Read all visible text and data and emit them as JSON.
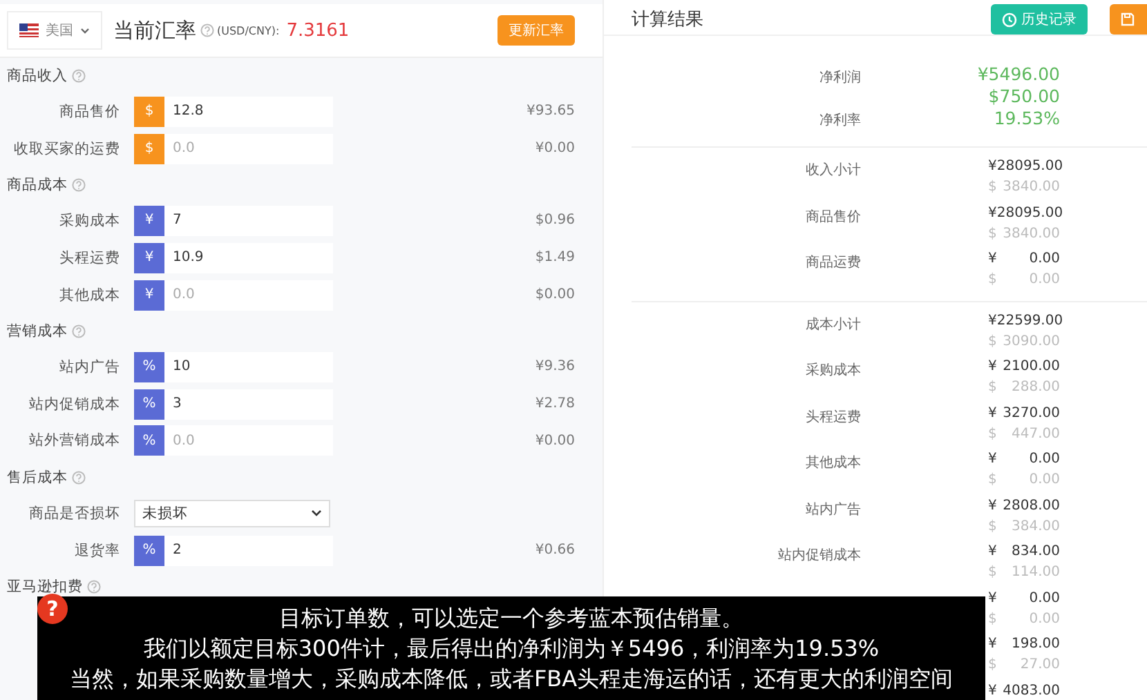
{
  "header": {
    "country": "美国",
    "rate_label": "当前汇率",
    "rate_unit": "(USD/CNY):",
    "rate_value": "7.3161",
    "update_button": "更新汇率"
  },
  "sections": [
    {
      "title": "商品收入",
      "rows": [
        {
          "kind": "input",
          "label": "商品售价",
          "prefix": "$",
          "color": "#f7931e",
          "value": "12.8",
          "converted": "¥93.65"
        },
        {
          "kind": "input",
          "label": "收取买家的运费",
          "prefix": "$",
          "color": "#f7931e",
          "placeholder": "0.0",
          "converted": "¥0.00"
        }
      ]
    },
    {
      "title": "商品成本",
      "rows": [
        {
          "kind": "input",
          "label": "采购成本",
          "prefix": "¥",
          "color": "#5b6bd5",
          "value": "7",
          "converted": "$0.96"
        },
        {
          "kind": "input",
          "label": "头程运费",
          "prefix": "¥",
          "color": "#5b6bd5",
          "value": "10.9",
          "converted": "$1.49"
        },
        {
          "kind": "input",
          "label": "其他成本",
          "prefix": "¥",
          "color": "#5b6bd5",
          "placeholder": "0.0",
          "converted": "$0.00"
        }
      ]
    },
    {
      "title": "营销成本",
      "rows": [
        {
          "kind": "input",
          "label": "站内广告",
          "prefix": "%",
          "color": "#5b6bd5",
          "value": "10",
          "converted": "¥9.36"
        },
        {
          "kind": "input",
          "label": "站内促销成本",
          "prefix": "%",
          "color": "#5b6bd5",
          "value": "3",
          "converted": "¥2.78"
        },
        {
          "kind": "input",
          "label": "站外营销成本",
          "prefix": "%",
          "color": "#5b6bd5",
          "placeholder": "0.0",
          "converted": "¥0.00"
        }
      ]
    },
    {
      "title": "售后成本",
      "rows": [
        {
          "kind": "select",
          "label": "商品是否损坏",
          "value": "未损坏"
        },
        {
          "kind": "input",
          "label": "退货率",
          "prefix": "%",
          "color": "#5b6bd5",
          "value": "2",
          "converted": "¥0.66"
        }
      ]
    },
    {
      "title": "亚马逊扣费"
    }
  ],
  "results": {
    "title": "计算结果",
    "buttons": [
      {
        "kind": "history",
        "label": "历史记录"
      },
      {
        "kind": "save"
      }
    ],
    "summary": [
      {
        "label": "净利润",
        "values": [
          "¥5496.00",
          "$750.00"
        ]
      },
      {
        "label": "净利率",
        "values": [
          "19.53%"
        ]
      }
    ],
    "groups": [
      [
        {
          "label": "收入小计",
          "cny": {
            "currency": "¥",
            "amount": "28095.00"
          },
          "usd": {
            "currency": "$",
            "amount": "3840.00"
          }
        },
        {
          "label": "商品售价",
          "cny": {
            "currency": "¥",
            "amount": "28095.00"
          },
          "usd": {
            "currency": "$",
            "amount": "3840.00"
          }
        },
        {
          "label": "商品运费",
          "cny": {
            "currency": "¥",
            "amount": "0.00"
          },
          "usd": {
            "currency": "$",
            "amount": "0.00"
          }
        }
      ],
      [
        {
          "label": "成本小计",
          "cny": {
            "currency": "¥",
            "amount": "22599.00"
          },
          "usd": {
            "currency": "$",
            "amount": "3090.00"
          }
        },
        {
          "label": "采购成本",
          "cny": {
            "currency": "¥",
            "amount": "2100.00"
          },
          "usd": {
            "currency": "$",
            "amount": "288.00"
          }
        },
        {
          "label": "头程运费",
          "cny": {
            "currency": "¥",
            "amount": "3270.00"
          },
          "usd": {
            "currency": "$",
            "amount": "447.00"
          }
        },
        {
          "label": "其他成本",
          "cny": {
            "currency": "¥",
            "amount": "0.00"
          },
          "usd": {
            "currency": "$",
            "amount": "0.00"
          }
        },
        {
          "label": "站内广告",
          "cny": {
            "currency": "¥",
            "amount": "2808.00"
          },
          "usd": {
            "currency": "$",
            "amount": "384.00"
          }
        },
        {
          "label": "站内促销成本",
          "cny": {
            "currency": "¥",
            "amount": "834.00"
          },
          "usd": {
            "currency": "$",
            "amount": "114.00"
          }
        },
        {
          "cny": {
            "currency": "¥",
            "amount": "0.00"
          },
          "usd": {
            "currency": "$",
            "amount": "0.00"
          }
        },
        {
          "cny": {
            "currency": "¥",
            "amount": "198.00"
          },
          "usd": {
            "currency": "$",
            "amount": "27.00"
          }
        },
        {
          "cny": {
            "currency": "¥",
            "amount": "4083.00"
          }
        }
      ]
    ]
  },
  "subtitle": {
    "badge": "?",
    "lines": [
      "目标订单数，可以选定一个参考蓝本预估销量。",
      "我们以额定目标300件计，最后得出的净利润为￥5496，利润率为19.53%",
      "当然，如果采购数量增大，采购成本降低，或者FBA头程走海运的话，还有更大的利润空间"
    ]
  }
}
